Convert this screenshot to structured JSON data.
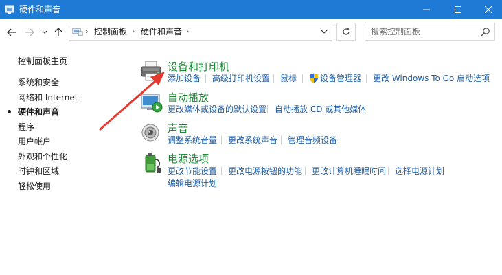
{
  "window": {
    "title": "硬件和声音",
    "accent": "#1f7ad6"
  },
  "address": {
    "crumbs": [
      "控制面板",
      "硬件和声音"
    ],
    "separator": "›"
  },
  "search": {
    "placeholder": "搜索控制面板"
  },
  "leftnav": {
    "items": [
      {
        "label": "控制面板主页"
      },
      {
        "label": "系统和安全"
      },
      {
        "label": "网络和 Internet"
      },
      {
        "label": "硬件和声音",
        "current": true
      },
      {
        "label": "程序"
      },
      {
        "label": "用户帐户"
      },
      {
        "label": "外观和个性化"
      },
      {
        "label": "时钟和区域"
      },
      {
        "label": "轻松使用"
      }
    ]
  },
  "categories": [
    {
      "title": "设备和打印机",
      "icon": "printer-icon",
      "links": [
        "添加设备",
        "高级打印机设置",
        "鼠标",
        "设备管理器",
        "更改 Windows To Go 启动选项"
      ]
    },
    {
      "title": "自动播放",
      "icon": "autoplay-icon",
      "links": [
        "更改媒体或设备的默认设置",
        "自动播放 CD 或其他媒体"
      ]
    },
    {
      "title": "声音",
      "icon": "speaker-icon",
      "links": [
        "调整系统音量",
        "更改系统声音",
        "管理音频设备"
      ]
    },
    {
      "title": "电源选项",
      "icon": "battery-icon",
      "links": [
        "更改节能设置",
        "更改电源按钮的功能",
        "更改计算机睡眠时间",
        "选择电源计划",
        "编辑电源计划"
      ]
    }
  ],
  "colors": {
    "category_title": "#1e8a37",
    "link": "#1f5fa8",
    "annotation_arrow": "#e53a2d"
  }
}
